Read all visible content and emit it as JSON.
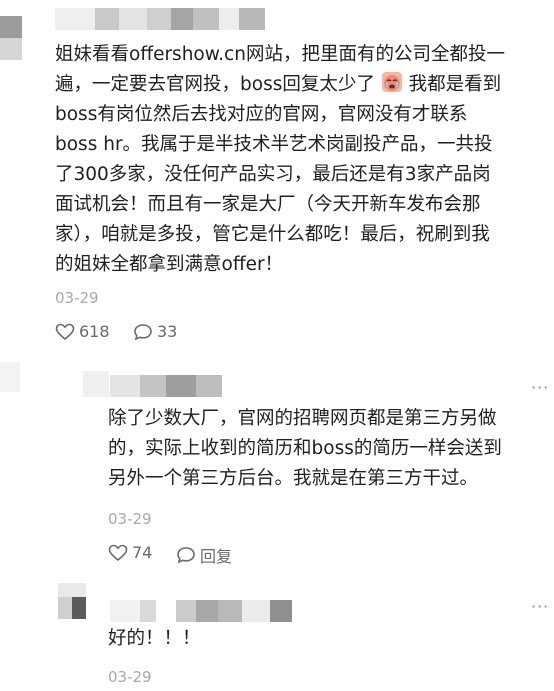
{
  "comments": [
    {
      "text_lines": [
        "姐妹看看offershow.cn网站，把里面有的公司全都投一",
        "遍，一定要去官网投，boss回复太少了",
        "boss有岗位然后去找对应的官网，官网没有才联系",
        "boss hr。我属于是半技术半艺术岗副投产品，一共投",
        "了300多家，没任何产品实习，最后还是有3家产品岗",
        "面试机会！而且有一家是大厂（今天开新车发布会那",
        "家），咱就是多投，管它是什么都吃！最后，祝刷到我",
        "的姐妹全都拿到满意offer！"
      ],
      "line2_tail": " 我都是看到",
      "date": "03-29",
      "likes": "618",
      "replies": "33",
      "more": "···"
    },
    {
      "text_lines": [
        "除了少数大厂，官网的招聘网页都是第三方另做",
        "的，实际上收到的简历和boss的简历一样会送到",
        "另外一个第三方后台。我就是在第三方干过。"
      ],
      "date": "03-29",
      "likes": "74",
      "reply_label": "回复",
      "more": "···"
    },
    {
      "text_lines": [
        "好的！！！"
      ],
      "date": "03-29",
      "more": "···"
    }
  ],
  "icons": {
    "like": "heart-outline-icon",
    "comment": "comment-bubble-icon",
    "emoji": "crying-face-emoji"
  }
}
